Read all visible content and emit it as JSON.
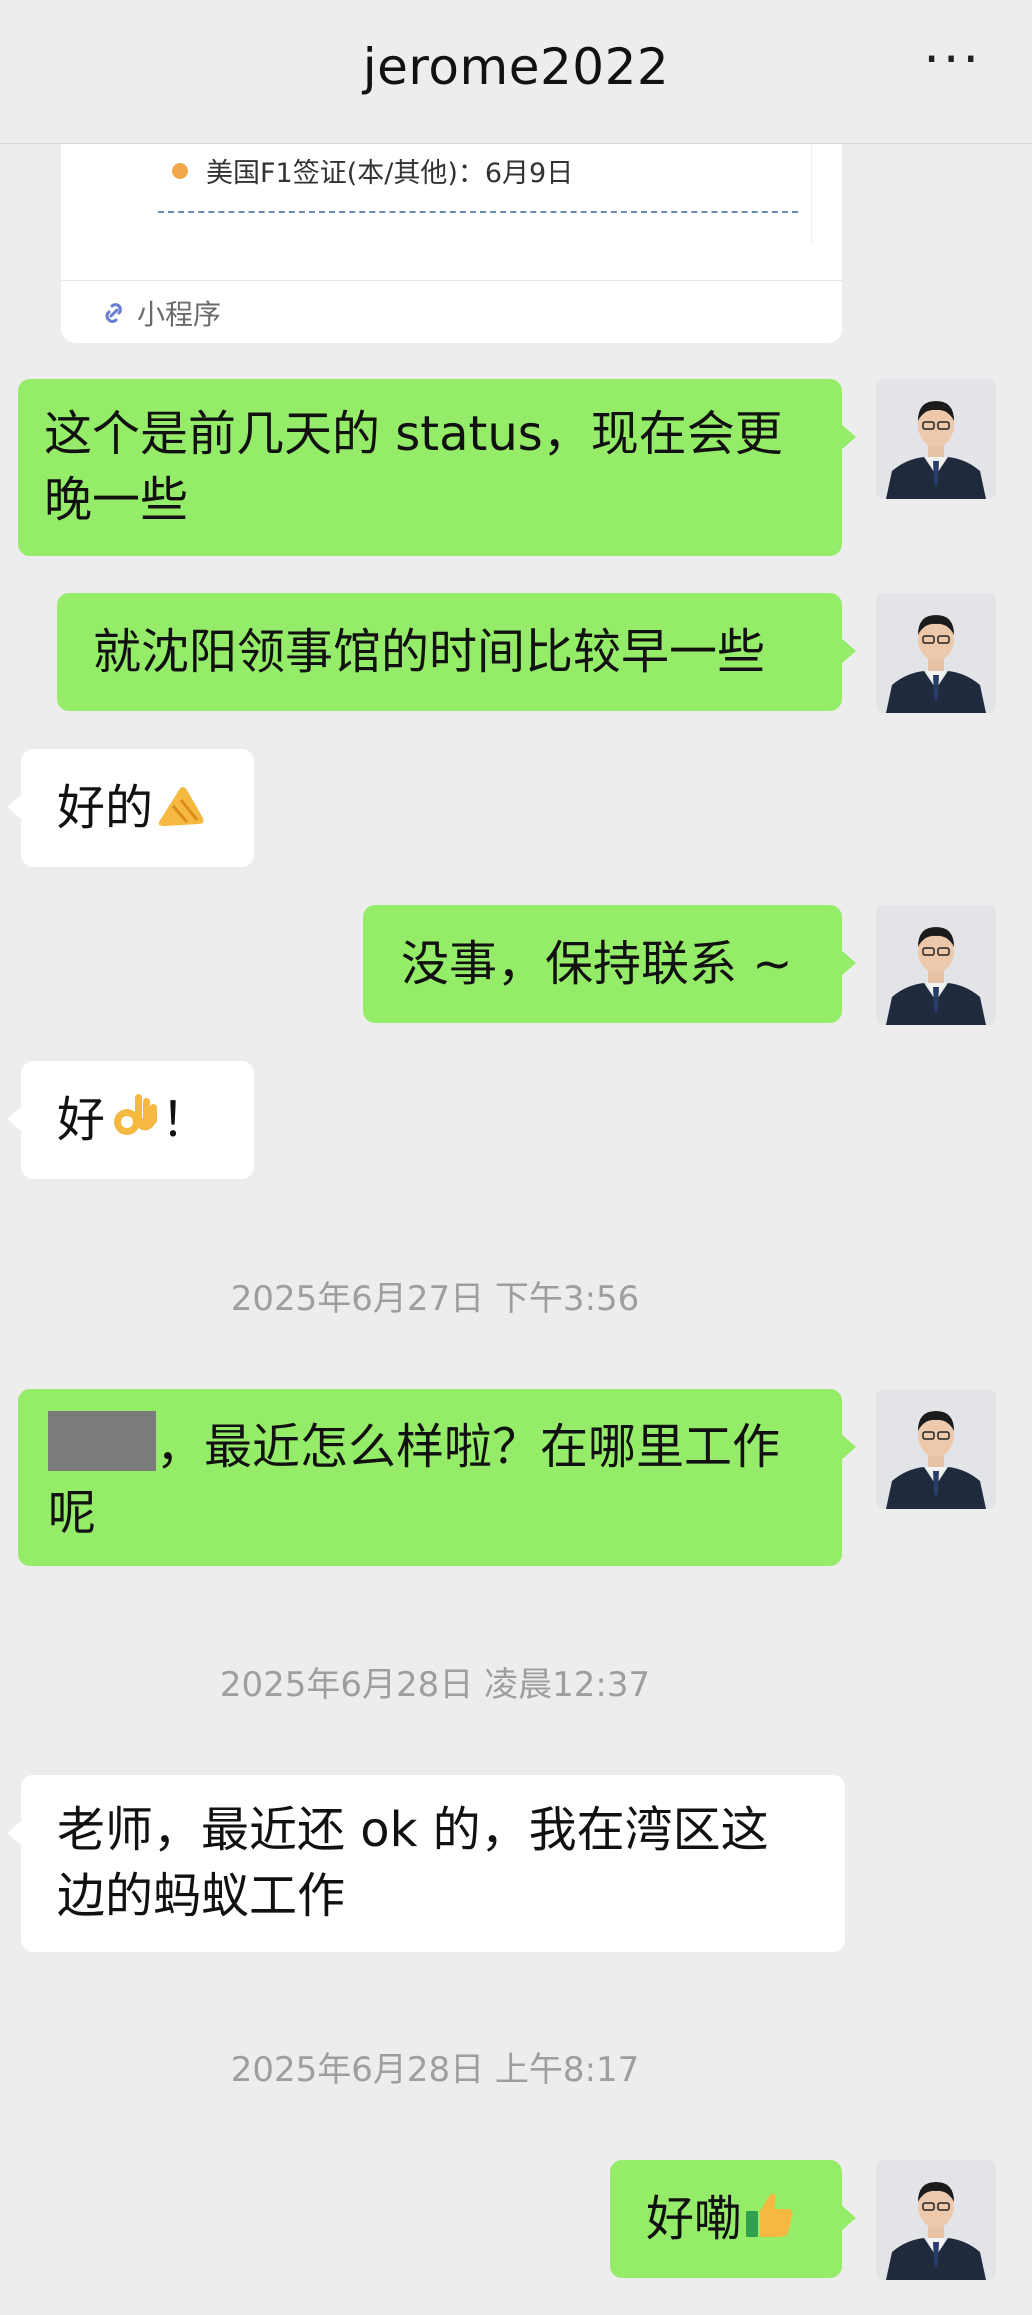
{
  "header": {
    "title": "jerome2022",
    "more_label": "···"
  },
  "card": {
    "visa_line": "美国F1签证(本/其他)：6月9日",
    "footer_label": "小程序"
  },
  "messages": [
    {
      "text_line1": "这个是前几天的 status，现在会更",
      "text_line2": "晚一些"
    },
    {
      "text": "就沈阳领事馆的时间比较早一些"
    },
    {
      "text": "好的"
    },
    {
      "text": "没事，保持联系 ~"
    },
    {
      "text_before": "好",
      "text_after": "！"
    },
    {
      "text_line1": "，最近怎么样啦？在哪里工作",
      "text_line2": "呢"
    },
    {
      "text_line1": "老师，最近还 ok 的，我在湾区这",
      "text_line2": "边的蚂蚁工作"
    },
    {
      "text": "好嘞"
    }
  ],
  "timestamps": [
    "2025年6月27日 下午3:56",
    "2025年6月28日 凌晨12:37",
    "2025年6月28日 上午8:17"
  ],
  "icons": {
    "more": "more-icon",
    "link": "link-icon",
    "pinched_hand": "pinched-fingers-emoji",
    "ok_hand": "ok-hand-emoji",
    "thumbs_up": "thumbs-up-emoji"
  },
  "colors": {
    "sent_bubble": "#95ec69",
    "received_bubble": "#ffffff",
    "background": "#ededed",
    "timestamp": "#9e9e9e"
  }
}
